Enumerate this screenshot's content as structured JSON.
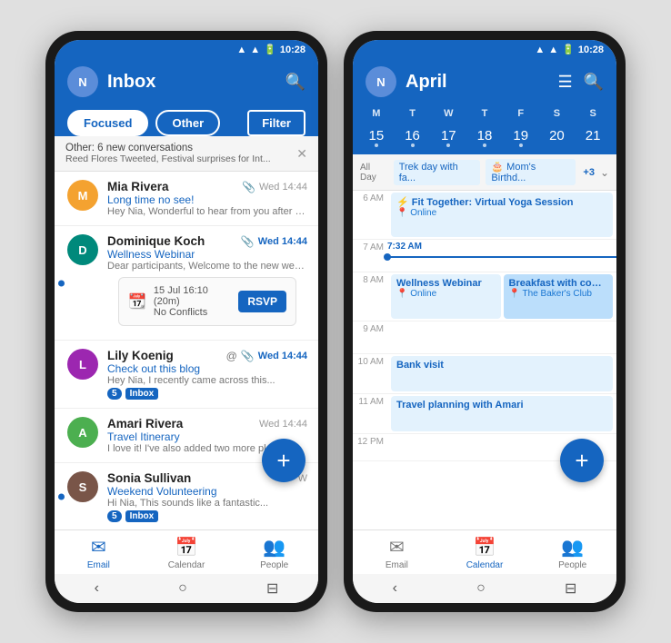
{
  "phone1": {
    "statusBar": {
      "time": "10:28"
    },
    "header": {
      "title": "Inbox",
      "searchLabel": "search"
    },
    "tabs": {
      "focused": "Focused",
      "other": "Other",
      "filter": "Filter"
    },
    "notification": {
      "line1": "Other: 6 new conversations",
      "line2": "Reed Flores Tweeted, Festival surprises for Int..."
    },
    "emails": [
      {
        "sender": "Mia Rivera",
        "subject": "",
        "preview": "Long time no see!",
        "preview2": "Hey Nia, Wonderful to hear from you after such...",
        "time": "Wed 14:44",
        "timeBlue": false,
        "unread": false,
        "clip": true,
        "at": false,
        "badge": null,
        "inbox": false,
        "avatarColor": "orange",
        "avatarLetter": "M"
      },
      {
        "sender": "Dominique Koch",
        "subject": "Wellness Webinar",
        "preview": "Dear participants, Welcome to the new webinar...",
        "time": "Wed 14:44",
        "timeBlue": true,
        "unread": true,
        "clip": true,
        "at": false,
        "badge": null,
        "inbox": false,
        "avatarColor": "teal",
        "avatarLetter": "D",
        "webinarCard": {
          "date": "15 Jul 16:10 (20m)",
          "conflicts": "No Conflicts",
          "rsvp": "RSVP"
        }
      },
      {
        "sender": "Lily Koenig",
        "subject": "Check out this blog",
        "preview": "Hey Nia, I recently came across this...",
        "time": "Wed 14:44",
        "timeBlue": true,
        "unread": false,
        "clip": true,
        "at": true,
        "badge": "5",
        "inbox": true,
        "avatarColor": "purple",
        "avatarLetter": "L"
      },
      {
        "sender": "Amari Rivera",
        "subject": "Travel Itinerary",
        "preview": "I love it! I've also added two more places to vis...",
        "time": "Wed 14:44",
        "timeBlue": false,
        "unread": false,
        "clip": false,
        "at": false,
        "badge": null,
        "inbox": false,
        "avatarColor": "green",
        "avatarLetter": "A"
      },
      {
        "sender": "Sonia Sullivan",
        "subject": "Weekend Volunteering",
        "preview": "Hi Nia, This sounds like a fantastic...",
        "time": "W",
        "timeBlue": false,
        "unread": true,
        "clip": false,
        "at": false,
        "badge": "5",
        "inbox": true,
        "avatarColor": "brown",
        "avatarLetter": "S"
      }
    ],
    "bottomNav": [
      {
        "label": "Email",
        "icon": "✉",
        "active": true
      },
      {
        "label": "Calendar",
        "icon": "📅",
        "active": false
      },
      {
        "label": "People",
        "icon": "👥",
        "active": false
      }
    ]
  },
  "phone2": {
    "statusBar": {
      "time": "10:28"
    },
    "header": {
      "title": "April"
    },
    "weekdays": [
      "M",
      "T",
      "W",
      "T",
      "F",
      "S",
      "S"
    ],
    "dates": [
      {
        "num": "15",
        "dot": true,
        "today": false
      },
      {
        "num": "16",
        "dot": true,
        "today": false
      },
      {
        "num": "17",
        "dot": true,
        "today": false
      },
      {
        "num": "18",
        "dot": true,
        "today": false
      },
      {
        "num": "19",
        "dot": true,
        "today": false
      },
      {
        "num": "20",
        "dot": false,
        "today": true
      },
      {
        "num": "21",
        "dot": false,
        "today": false
      }
    ],
    "allDay": {
      "label": "All Day",
      "events": [
        "Trek day with fa...",
        "🎂 Mom's Birthd..."
      ],
      "more": "+3"
    },
    "timeSlots": [
      {
        "time": "6 AM",
        "events": [
          {
            "title": "⚡ Fit Together: Virtual Yoga Session",
            "loc": "Online",
            "color": "blue-light",
            "wide": true
          }
        ]
      },
      {
        "time": "7 AM",
        "events": []
      },
      {
        "time": "8 AM",
        "events": [
          {
            "title": "Wellness Webinar",
            "loc": "Online",
            "color": "blue-light"
          },
          {
            "title": "Breakfast with cous...",
            "loc": "The Baker's Club",
            "color": "blue-solid"
          }
        ],
        "marker": {
          "label": "7:32 AM"
        }
      },
      {
        "time": "9 AM",
        "events": []
      },
      {
        "time": "10 AM",
        "events": [
          {
            "title": "Bank visit",
            "loc": "",
            "color": "blue-light",
            "wide": true
          }
        ]
      },
      {
        "time": "11 AM",
        "events": [
          {
            "title": "Travel planning with Amari",
            "loc": "",
            "color": "blue-light",
            "wide": true
          }
        ]
      }
    ],
    "bottomNav": [
      {
        "label": "Email",
        "icon": "✉",
        "active": false
      },
      {
        "label": "Calendar",
        "icon": "📅",
        "active": true
      },
      {
        "label": "People",
        "icon": "👥",
        "active": false
      }
    ]
  }
}
